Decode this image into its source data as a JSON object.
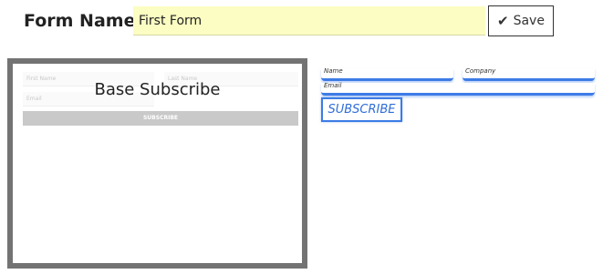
{
  "header": {
    "form_name_label": "Form Name:",
    "form_name_value": "First Form",
    "save_label": "Save"
  },
  "template_card": {
    "title": "Base Subscribe",
    "fields": {
      "first_name": "First Name",
      "last_name": "Last Name",
      "email": "Email"
    },
    "button_label": "SUBSCRIBE"
  },
  "live_form": {
    "name_placeholder": "Name",
    "company_placeholder": "Company",
    "email_placeholder": "Email",
    "button_label": "SUBSCRIBE"
  },
  "colors": {
    "accent_blue": "#3d7be6",
    "form_name_bg": "#fbfdc2",
    "card_border": "#737373"
  },
  "icons": {
    "save": "check-icon"
  }
}
